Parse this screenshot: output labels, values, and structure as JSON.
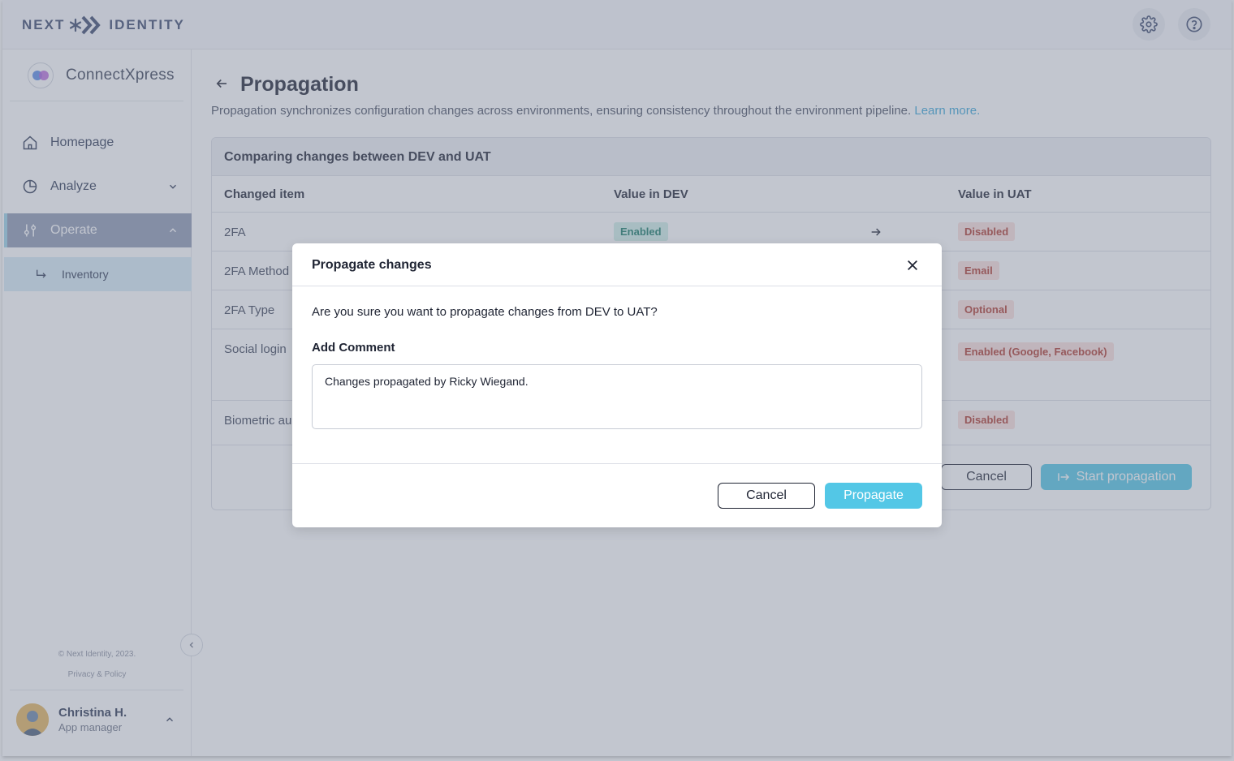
{
  "brand": {
    "logo_left": "NEXT",
    "logo_right": "IDENTITY",
    "app_name": "ConnectXpress"
  },
  "topbar": {
    "settings_icon": "gear-icon",
    "help_icon": "help-circle-icon"
  },
  "sidebar": {
    "items": [
      {
        "label": "Homepage",
        "icon": "home-icon"
      },
      {
        "label": "Analyze",
        "icon": "pie-chart-icon"
      },
      {
        "label": "Operate",
        "icon": "sliders-icon"
      }
    ],
    "sub_item": {
      "label": "Inventory",
      "icon": "return-arrow-icon"
    },
    "copyright": "© Next Identity, 2023.",
    "privacy": "Privacy & Policy",
    "user": {
      "name": "Christina H.",
      "role": "App manager"
    }
  },
  "page": {
    "title": "Propagation",
    "description": "Propagation synchronizes configuration changes across environments, ensuring consistency throughout the environment pipeline.",
    "learn_more": "Learn more."
  },
  "comparison": {
    "title": "Comparing changes between DEV and UAT",
    "columns": [
      "Changed item",
      "Value in DEV",
      "Value in UAT"
    ],
    "rows": [
      {
        "item": "2FA",
        "dev": "Enabled",
        "uat": "Disabled"
      },
      {
        "item": "2FA Method",
        "dev": "",
        "uat": "Email"
      },
      {
        "item": "2FA Type",
        "dev": "",
        "uat": "Optional"
      },
      {
        "item": "Social login",
        "dev": "",
        "uat": "Enabled (Google, Facebook)"
      },
      {
        "item": "Biometric au",
        "dev": "",
        "uat": "Disabled"
      }
    ],
    "cancel_label": "Cancel",
    "start_label": "Start propagation"
  },
  "modal": {
    "title": "Propagate changes",
    "question": "Are you sure you want to propagate changes from DEV to UAT?",
    "comment_label": "Add Comment",
    "comment_value": "Changes propagated by Ricky Wiegand.",
    "cancel_label": "Cancel",
    "confirm_label": "Propagate"
  },
  "colors": {
    "accent": "#53c7e6",
    "enabled_bg": "#cfeee8",
    "disabled_bg": "#fbe0dc",
    "overlay": "rgba(120,128,148,0.45)"
  }
}
